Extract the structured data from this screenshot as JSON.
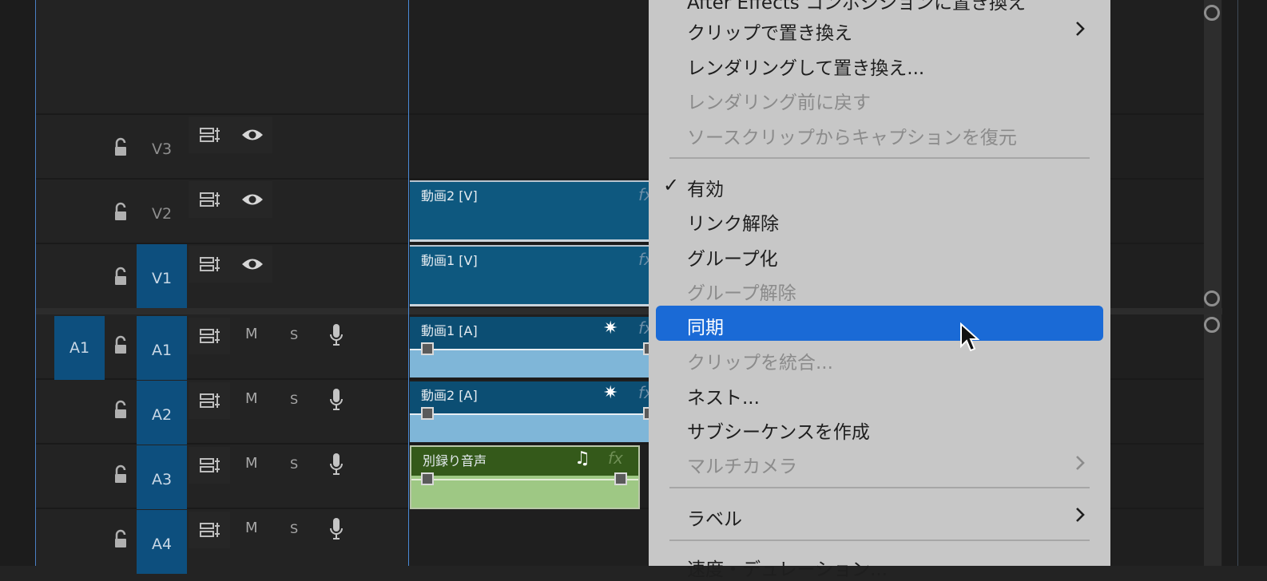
{
  "tracks": {
    "video": [
      {
        "name": "V3",
        "active": false
      },
      {
        "name": "V2",
        "active": false
      },
      {
        "name": "V1",
        "active": true
      }
    ],
    "audio": [
      {
        "name": "A1",
        "source_patch": "A1",
        "active": true
      },
      {
        "name": "A2",
        "active": true
      },
      {
        "name": "A3",
        "active": true
      },
      {
        "name": "A4",
        "active": true
      }
    ],
    "mute_label": "M",
    "solo_label": "S"
  },
  "clips": {
    "v2": {
      "label": "動画2 [V]",
      "fx": "fx"
    },
    "v1": {
      "label": "動画1 [V]",
      "fx": "fx"
    },
    "a1": {
      "label": "動画1 [A]",
      "fx": "fx"
    },
    "a2": {
      "label": "動画2 [A]",
      "fx": "fx"
    },
    "a3": {
      "label": "別録り音声",
      "fx": "fx"
    }
  },
  "context_menu": {
    "items": [
      {
        "label": "After Effects コンポジションに置き換え",
        "enabled": true
      },
      {
        "label": "クリップで置き換え",
        "enabled": true,
        "submenu": true
      },
      {
        "label": "レンダリングして置き換え...",
        "enabled": true
      },
      {
        "label": "レンダリング前に戻す",
        "enabled": false
      },
      {
        "label": "ソースクリップからキャプションを復元",
        "enabled": false
      },
      {
        "label": "有効",
        "enabled": true,
        "checked": true
      },
      {
        "label": "リンク解除",
        "enabled": true
      },
      {
        "label": "グループ化",
        "enabled": true
      },
      {
        "label": "グループ解除",
        "enabled": false
      },
      {
        "label": "同期",
        "enabled": true,
        "highlighted": true
      },
      {
        "label": "クリップを統合...",
        "enabled": false
      },
      {
        "label": "ネスト...",
        "enabled": true
      },
      {
        "label": "サブシーケンスを作成",
        "enabled": true
      },
      {
        "label": "マルチカメラ",
        "enabled": false,
        "submenu": true
      },
      {
        "label": "ラベル",
        "enabled": true,
        "submenu": true
      },
      {
        "label": "速度・デュレーション...",
        "enabled": true
      }
    ],
    "check_mark": "✓"
  },
  "colors": {
    "highlight": "#1a6ad6",
    "track_active": "#0d4f7e",
    "video_clip": "#0e587f",
    "audio_clip_green": "#34591a"
  }
}
